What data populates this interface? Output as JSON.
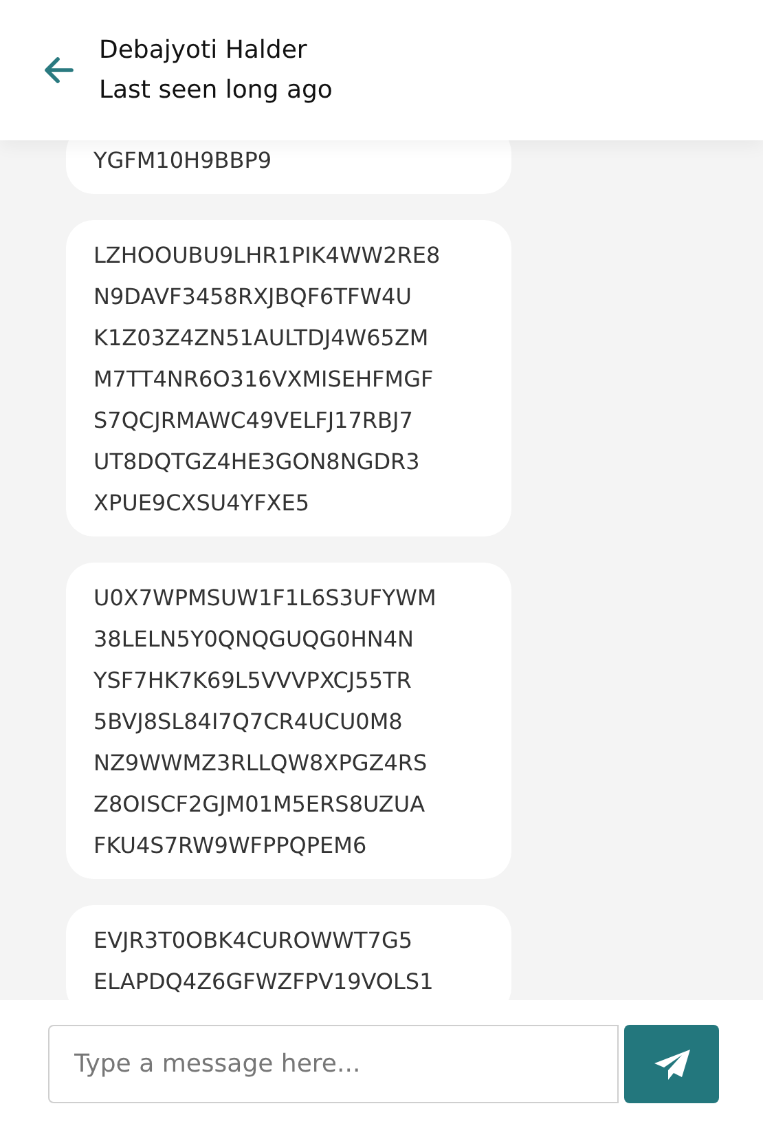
{
  "header": {
    "name": "Debajyoti Halder",
    "status": "Last seen long ago"
  },
  "messages": [
    {
      "lines": [
        "YGFM10H9BBP9"
      ]
    },
    {
      "lines": [
        "LZHOOUBU9LHR1PIK4WW2RE8",
        "N9DAVF3458RXJBQF6TFW4U",
        "K1Z03Z4ZN51AULTDJ4W65ZM",
        "M7TT4NR6O316VXMISEHFMGF",
        "S7QCJRMAWC49VELFJ17RBJ7",
        "UT8DQTGZ4HE3GON8NGDR3",
        "XPUE9CXSU4YFXE5"
      ]
    },
    {
      "lines": [
        "U0X7WPMSUW1F1L6S3UFYWM",
        "38LELN5Y0QNQGUQG0HN4N",
        "YSF7HK7K69L5VVVPXCJ55TR",
        "5BVJ8SL84I7Q7CR4UCU0M8",
        "NZ9WWMZ3RLLQW8XPGZ4RS",
        "Z8OISCF2GJM01M5ERS8UZUA",
        "FKU4S7RW9WFPPQPEM6"
      ]
    },
    {
      "lines": [
        "EVJR3T0OBK4CUROWWT7G5",
        "ELAPDQ4Z6GFWZFPV19VOLS1"
      ]
    }
  ],
  "composer": {
    "placeholder": "Type a message here..."
  }
}
